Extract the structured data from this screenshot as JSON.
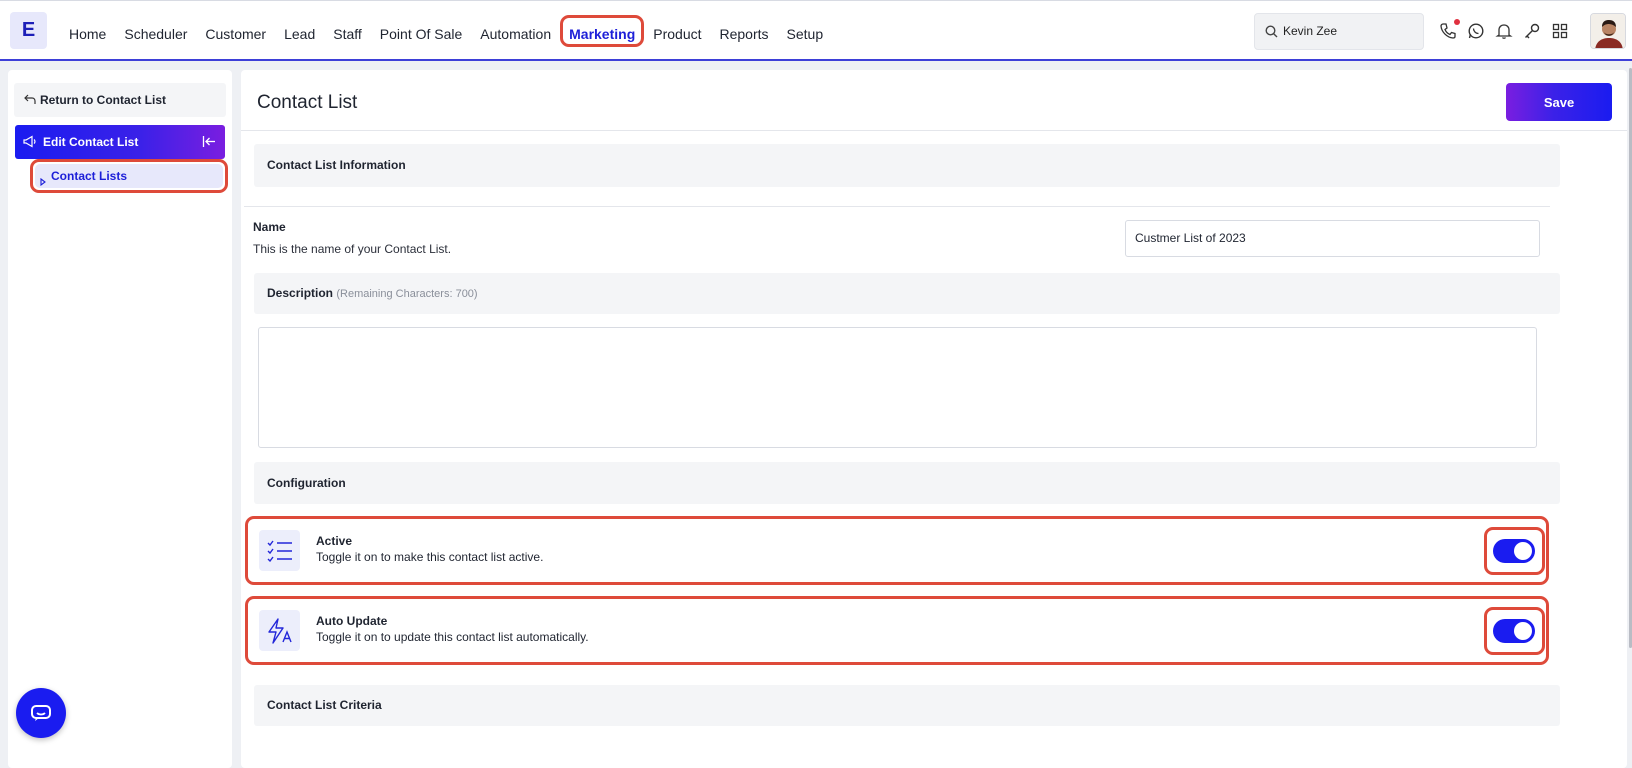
{
  "colors": {
    "accent": "#1a1cf0",
    "highlight": "#de4a3a",
    "gradient_end": "#7a1ee0"
  },
  "topbar": {
    "logo": "E",
    "nav": [
      {
        "label": "Home",
        "active": false
      },
      {
        "label": "Scheduler",
        "active": false
      },
      {
        "label": "Customer",
        "active": false
      },
      {
        "label": "Lead",
        "active": false
      },
      {
        "label": "Staff",
        "active": false
      },
      {
        "label": "Point Of Sale",
        "active": false
      },
      {
        "label": "Automation",
        "active": false
      },
      {
        "label": "Marketing",
        "active": true
      },
      {
        "label": "Product",
        "active": false
      },
      {
        "label": "Reports",
        "active": false
      },
      {
        "label": "Setup",
        "active": false
      }
    ],
    "search_value": "Kevin Zee",
    "icons": [
      "phone-icon",
      "whatsapp-icon",
      "bell-icon",
      "key-icon",
      "grid-icon",
      "avatar"
    ]
  },
  "sidebar": {
    "return_label": "Return to Contact List",
    "edit_label": "Edit Contact List",
    "items": [
      {
        "label": "Contact Lists"
      }
    ]
  },
  "main": {
    "title": "Contact List",
    "save_label": "Save",
    "info_section": "Contact List Information",
    "name_label": "Name",
    "name_help": "This is the name of your Contact List.",
    "name_value": "Custmer List of 2023",
    "description_label": "Description",
    "description_remaining": "(Remaining Characters: 700)",
    "description_value": "",
    "config_section": "Configuration",
    "toggles": [
      {
        "title": "Active",
        "description": "Toggle it on to make this contact list active.",
        "on": true,
        "icon": "checklist-icon"
      },
      {
        "title": "Auto Update",
        "description": "Toggle it on to update this contact list automatically.",
        "on": true,
        "icon": "auto-update-icon"
      }
    ],
    "criteria_section": "Contact List Criteria"
  }
}
